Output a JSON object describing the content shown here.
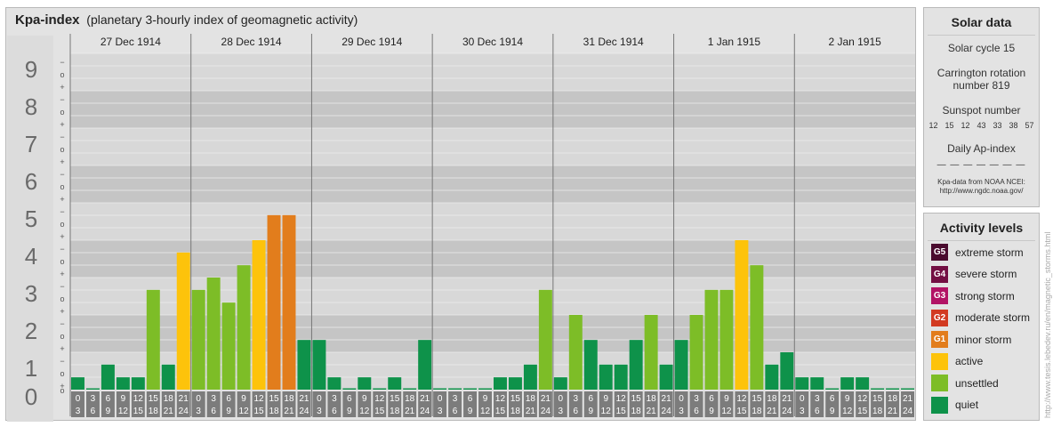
{
  "title": {
    "bold": "Kpa-index",
    "rest": "(planetary 3-hourly index of geomagnetic activity)"
  },
  "chart_data": {
    "type": "bar",
    "title": "Kpa-index",
    "subtitle": "(planetary 3-hourly index of geomagnetic activity)",
    "ylim": [
      0,
      9
    ],
    "y_ticks": [
      "0",
      "1",
      "2",
      "3",
      "4",
      "5",
      "6",
      "7",
      "8",
      "9"
    ],
    "sub_ticks": [
      "+",
      "o",
      "−"
    ],
    "days": [
      "27 Dec 1914",
      "28 Dec 1914",
      "29 Dec 1914",
      "30 Dec 1914",
      "31 Dec 1914",
      "1 Jan 1915",
      "2 Jan 1915"
    ],
    "x_ticks_top": [
      "0",
      "3",
      "6",
      "9",
      "12",
      "15",
      "18",
      "21"
    ],
    "x_ticks_bottom": [
      "3",
      "6",
      "9",
      "12",
      "15",
      "18",
      "21",
      "24"
    ],
    "values": [
      [
        0.33,
        0,
        0.67,
        0.33,
        0.33,
        2.67,
        0.67,
        3.67
      ],
      [
        2.67,
        3,
        2.33,
        3.33,
        4,
        4.67,
        4.67,
        1.33
      ],
      [
        1.33,
        0.33,
        0,
        0.33,
        0,
        0.33,
        0,
        1.33
      ],
      [
        0,
        0,
        0,
        0,
        0.33,
        0.33,
        0.67,
        2.67
      ],
      [
        0.33,
        2,
        1.33,
        0.67,
        0.67,
        1.33,
        2,
        0.67
      ],
      [
        1.33,
        2,
        2.67,
        2.67,
        4,
        3.33,
        0.67,
        1
      ],
      [
        0.33,
        0.33,
        0,
        0.33,
        0.33,
        0,
        0,
        0
      ]
    ],
    "colors": {
      "quiet": "#0e924a",
      "unsettled": "#7dbd27",
      "active": "#fdc30b",
      "minor": "#e27d1c",
      "axis_box": "#7c7c7c",
      "band_dark": "#c5c5c5",
      "band_light": "#d8d8d8"
    }
  },
  "solar": {
    "header": "Solar data",
    "cycle": "Solar cycle 15",
    "rotation_line1": "Carrington rotation",
    "rotation_line2": "number 819",
    "sunspot_label": "Sunspot number",
    "sunspot_values": [
      "12",
      "15",
      "12",
      "43",
      "33",
      "38",
      "57"
    ],
    "ap_label": "Daily Ap-index",
    "ap_values": "— — — — — — —",
    "credit_line1": "Kpa-data from NOAA NCEI:",
    "credit_line2": "http://www.ngdc.noaa.gov/"
  },
  "activity": {
    "header": "Activity levels",
    "levels": [
      {
        "badge": "G5",
        "label": "extreme storm",
        "color": "#4a0b2e"
      },
      {
        "badge": "G4",
        "label": "severe storm",
        "color": "#730f43"
      },
      {
        "badge": "G3",
        "label": "strong storm",
        "color": "#b21365"
      },
      {
        "badge": "G2",
        "label": "moderate storm",
        "color": "#d23a21"
      },
      {
        "badge": "G1",
        "label": "minor storm",
        "color": "#e27d1c"
      },
      {
        "badge": "",
        "label": "active",
        "color": "#fdc30b"
      },
      {
        "badge": "",
        "label": "unsettled",
        "color": "#7dbd27"
      },
      {
        "badge": "",
        "label": "quiet",
        "color": "#0e924a"
      }
    ]
  },
  "side_url": "http://www.tesis.lebedev.ru/en/magnetic_storms.html"
}
